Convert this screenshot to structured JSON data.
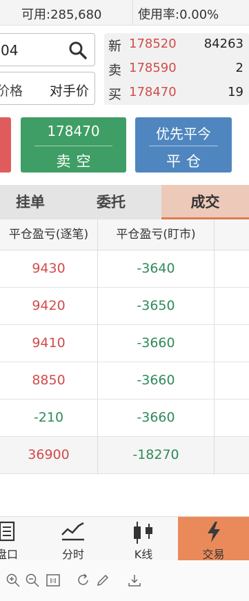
{
  "topbar": {
    "available": "可用:285,680",
    "usage": "使用率:0.00%"
  },
  "order": {
    "code_value": "04",
    "price_label": "价格",
    "price_mode": "对手价"
  },
  "quote": [
    {
      "key": "新",
      "price": "178520",
      "volume": "84263"
    },
    {
      "key": "卖",
      "price": "178590",
      "volume": "2"
    },
    {
      "key": "买",
      "price": "178470",
      "volume": "19"
    }
  ],
  "buttons": {
    "sell_short_price": "178470",
    "sell_short_label": "卖空",
    "close_top": "优先平今",
    "close_label": "平仓"
  },
  "tabs": [
    "挂单",
    "委托",
    "成交"
  ],
  "table": {
    "headers": [
      "平仓盈亏(逐笔)",
      "平仓盈亏(盯市)"
    ],
    "rows": [
      [
        "9430",
        "-3640"
      ],
      [
        "9420",
        "-3650"
      ],
      [
        "9410",
        "-3660"
      ],
      [
        "8850",
        "-3660"
      ],
      [
        "-210",
        "-3660"
      ],
      [
        "36900",
        "-18270"
      ]
    ]
  },
  "nav": [
    {
      "label": "盘口",
      "icon": "order-book-icon"
    },
    {
      "label": "分时",
      "icon": "timeshare-chart-icon"
    },
    {
      "label": "K线",
      "icon": "candlestick-icon"
    },
    {
      "label": "交易",
      "icon": "lightning-icon"
    }
  ],
  "colors": {
    "up": "#d34a4a",
    "down": "#2f8a5a",
    "sell_button": "#3f9e65",
    "close_button": "#4f86bf",
    "buy_button": "#e05b5b",
    "active_accent": "#ea8a5a"
  }
}
